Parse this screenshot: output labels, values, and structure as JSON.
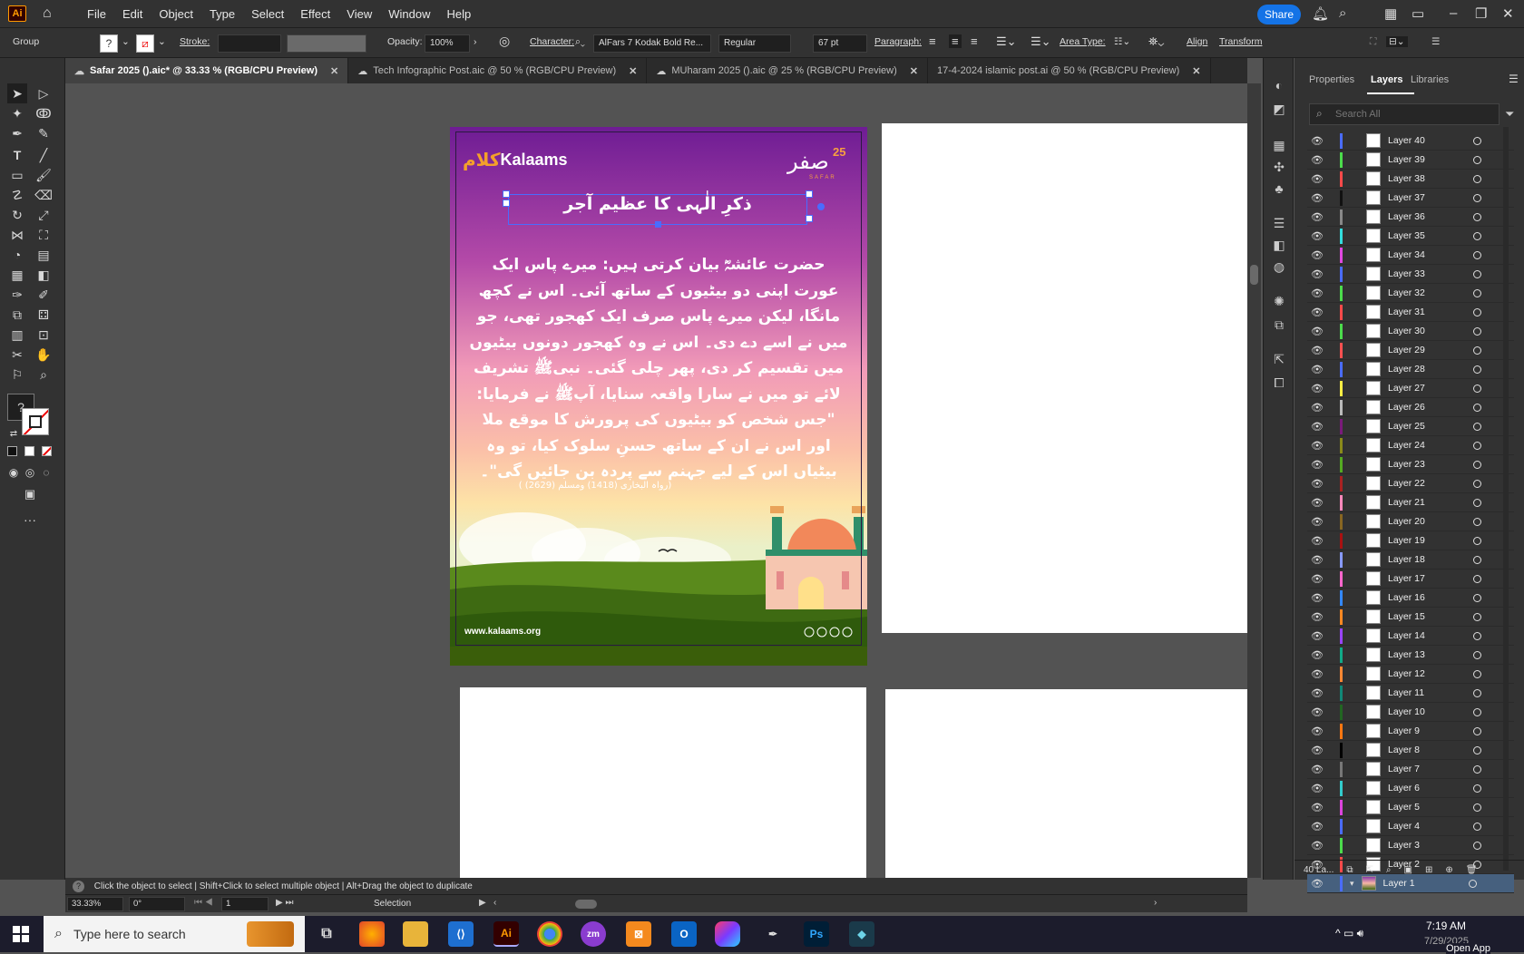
{
  "menubar": {
    "items": [
      "File",
      "Edit",
      "Object",
      "Type",
      "Select",
      "Effect",
      "View",
      "Window",
      "Help"
    ],
    "share_label": "Share"
  },
  "control": {
    "selection": "Group",
    "stroke_label": "Stroke:",
    "opacity_label": "Opacity:",
    "opacity_value": "100%",
    "character_label": "Character:",
    "font_name": "AlFars 7 Kodak Bold Re...",
    "font_style": "Regular",
    "font_size": "67 pt",
    "paragraph_label": "Paragraph:",
    "area_type_label": "Area Type:",
    "align_label": "Align",
    "transform_label": "Transform"
  },
  "tabs": [
    {
      "label": "Safar 2025 ().aic* @ 33.33 % (RGB/CPU Preview)",
      "active": true
    },
    {
      "label": "Tech Infographic Post.aic @ 50 % (RGB/CPU Preview)",
      "active": false
    },
    {
      "label": "MUharam 2025 ().aic @ 25 % (RGB/CPU Preview)",
      "active": false
    },
    {
      "label": "17-4-2024 islamic post.ai @ 50 % (RGB/CPU Preview)",
      "active": false
    }
  ],
  "artboard": {
    "brand": "Kalaams",
    "brand_urdu": "کلام",
    "safar_logo": "صفر",
    "safar_num": "25",
    "safar_sub": "SAFAR",
    "heading": "ذکرِ الٰہی کا عظیم آجر",
    "body": "حضرت عائشہؓ بیان کرتی ہیں: میرے پاس ایک عورت اپنی دو بیٹیوں کے ساتھ آئی۔ اس نے کچھ مانگا، لیکن میرے پاس صرف ایک کھجور تھی، جو میں نے اسے دے دی۔ اس نے وہ کھجور دونوں بیٹیوں میں تقسیم کر دی، پھر چلی گئی۔ نبیﷺ تشریف لائے تو میں نے سارا واقعہ سنایا، آپﷺ نے فرمایا: \"جس شخص کو بیٹیوں کی پرورش کا موقع ملا اور اس نے ان کے ساتھ حسنِ سلوک کیا، تو وہ بیٹیاں اس کے لیے جہنم سے پردہ بن جائیں گی\"۔",
    "reference": "(رواہ البخاری (1418) ومسلم (2629) )",
    "website": "www.kalaams.org"
  },
  "panel": {
    "tabs": [
      "Properties",
      "Layers",
      "Libraries"
    ],
    "active_tab": "Layers",
    "search_placeholder": "Search All",
    "layer_count": "40 La..."
  },
  "layers": [
    {
      "name": "Layer 40",
      "color": "#4a6cff"
    },
    {
      "name": "Layer 39",
      "color": "#4cdc4c"
    },
    {
      "name": "Layer 38",
      "color": "#ff4a4a"
    },
    {
      "name": "Layer 37",
      "color": "#111111"
    },
    {
      "name": "Layer 36",
      "color": "#888888"
    },
    {
      "name": "Layer 35",
      "color": "#33dddd"
    },
    {
      "name": "Layer 34",
      "color": "#e048e0"
    },
    {
      "name": "Layer 33",
      "color": "#4a6cff"
    },
    {
      "name": "Layer 32",
      "color": "#4cdc4c"
    },
    {
      "name": "Layer 31",
      "color": "#ff4a4a"
    },
    {
      "name": "Layer 30",
      "color": "#4cdc4c"
    },
    {
      "name": "Layer 29",
      "color": "#ff5050"
    },
    {
      "name": "Layer 28",
      "color": "#4a6cff"
    },
    {
      "name": "Layer 27",
      "color": "#ffee44"
    },
    {
      "name": "Layer 26",
      "color": "#bbbbbb"
    },
    {
      "name": "Layer 25",
      "color": "#7a1a7a"
    },
    {
      "name": "Layer 24",
      "color": "#8a8a1a"
    },
    {
      "name": "Layer 23",
      "color": "#55aa22"
    },
    {
      "name": "Layer 22",
      "color": "#aa2222"
    },
    {
      "name": "Layer 21",
      "color": "#ff88bb"
    },
    {
      "name": "Layer 20",
      "color": "#886622"
    },
    {
      "name": "Layer 19",
      "color": "#aa1111"
    },
    {
      "name": "Layer 18",
      "color": "#8899ff"
    },
    {
      "name": "Layer 17",
      "color": "#ff66cc"
    },
    {
      "name": "Layer 16",
      "color": "#3388ff"
    },
    {
      "name": "Layer 15",
      "color": "#ff8822"
    },
    {
      "name": "Layer 14",
      "color": "#9944ff"
    },
    {
      "name": "Layer 13",
      "color": "#11aa88"
    },
    {
      "name": "Layer 12",
      "color": "#ff8833"
    },
    {
      "name": "Layer 11",
      "color": "#118877"
    },
    {
      "name": "Layer 10",
      "color": "#226622"
    },
    {
      "name": "Layer 9",
      "color": "#ff7711"
    },
    {
      "name": "Layer 8",
      "color": "#000000"
    },
    {
      "name": "Layer 7",
      "color": "#777777"
    },
    {
      "name": "Layer 6",
      "color": "#33cccc"
    },
    {
      "name": "Layer 5",
      "color": "#dd44dd"
    },
    {
      "name": "Layer 4",
      "color": "#4a6cff"
    },
    {
      "name": "Layer 3",
      "color": "#4cdc4c"
    },
    {
      "name": "Layer 2",
      "color": "#ff4a4a"
    },
    {
      "name": "Layer 1",
      "color": "#4a6cff"
    }
  ],
  "status": {
    "hint": "Click the object to select  |  Shift+Click to select multiple object  |  Alt+Drag the object to duplicate",
    "zoom": "33.33%",
    "rotation": "0°",
    "artboard_num": "1",
    "tool": "Selection"
  },
  "taskbar": {
    "search_placeholder": "Type here to search",
    "time": "7:19 AM",
    "date": "7/29/2025",
    "open_app": "Open App"
  }
}
